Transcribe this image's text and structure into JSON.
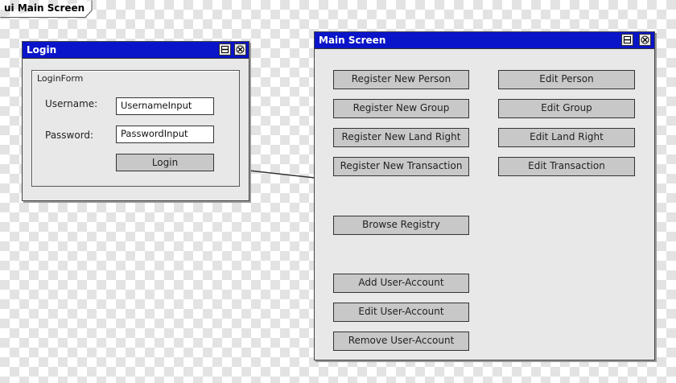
{
  "frame": {
    "title": "ui Main Screen"
  },
  "login_window": {
    "title": "Login",
    "group_label": "LoginForm",
    "username_label": "Username:",
    "username_value": "UsernameInput",
    "password_label": "Password:",
    "password_value": "PasswordInput",
    "login_button": "Login"
  },
  "main_window": {
    "title": "Main Screen",
    "left_buttons": [
      "Register New Person",
      "Register New Group",
      "Register New Land Right",
      "Register New Transaction",
      "Browse Registry",
      "Add User-Account",
      "Edit User-Account",
      "Remove User-Account"
    ],
    "right_buttons": [
      "Edit Person",
      "Edit Group",
      "Edit Land Right",
      "Edit Transaction"
    ]
  },
  "icons": {
    "maximize": "maximize-icon",
    "close": "close-icon"
  },
  "colors": {
    "titlebar": "#0a14c8",
    "window_bg": "#e8e8e8",
    "button_bg": "#c8c8c8"
  }
}
